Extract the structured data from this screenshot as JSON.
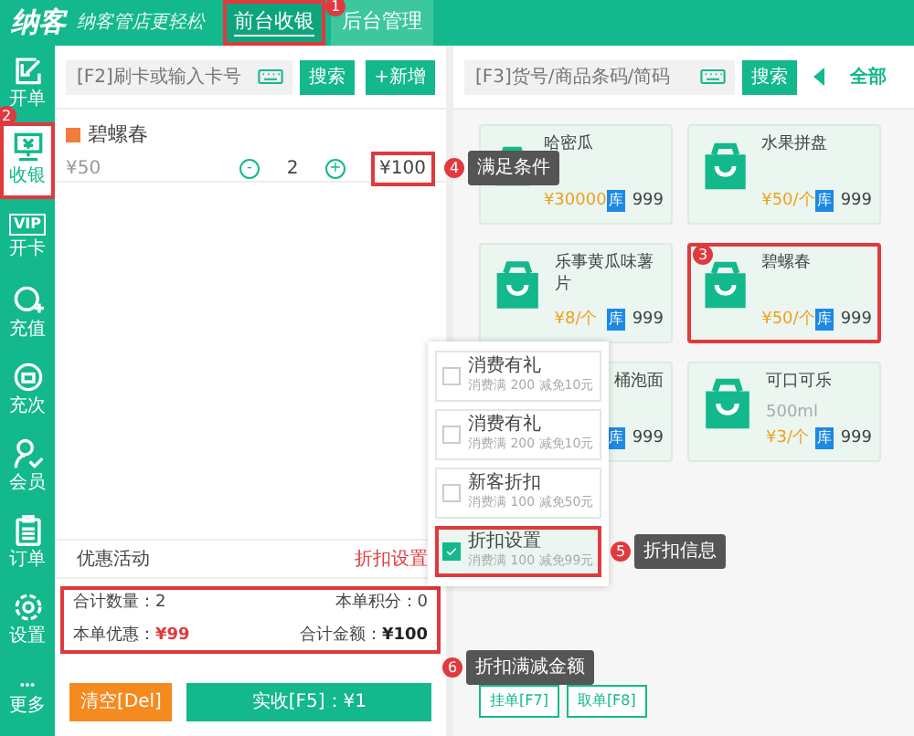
{
  "header": {
    "logo": "纳客",
    "slogan": "纳客管店更轻松",
    "tabs": [
      {
        "label": "前台收银",
        "selected": true,
        "highlight": true,
        "callout": "1"
      },
      {
        "label": "后台管理",
        "selected": false
      }
    ]
  },
  "sidebar": {
    "items": [
      {
        "label": "开单",
        "selected": false
      },
      {
        "label": "收银",
        "selected": true,
        "highlight": true,
        "callout": "2"
      },
      {
        "label": "开卡",
        "icon_text": "VIP",
        "selected": false
      },
      {
        "label": "充值",
        "selected": false
      },
      {
        "label": "充次",
        "selected": false
      },
      {
        "label": "会员",
        "selected": false
      },
      {
        "label": "订单",
        "selected": false
      },
      {
        "label": "设置",
        "selected": false
      },
      {
        "label": "更多",
        "selected": false
      }
    ]
  },
  "cart": {
    "search_placeholder": "[F2]刷卡或输入卡号",
    "search_button": "搜索",
    "add_button": "+新增",
    "items": [
      {
        "name": "碧螺春",
        "unit_price": "¥50",
        "minus": "-",
        "quantity": "2",
        "plus": "+",
        "subtotal": "¥100",
        "highlight": true,
        "callout": "4",
        "tooltip": "满足条件"
      }
    ],
    "promotion": {
      "label": "优惠活动",
      "value": "折扣设置"
    },
    "summary": {
      "highlight": true,
      "callout": "6",
      "tooltip": "折扣满减金额",
      "fields": [
        {
          "label": "合计数量：",
          "value": "2",
          "kind": "plain"
        },
        {
          "label": "本单积分：",
          "value": "0",
          "kind": "plain"
        },
        {
          "label": "本单优惠：",
          "value": "¥99",
          "kind": "discount"
        },
        {
          "label": "合计金额：",
          "value": "¥100",
          "kind": "total"
        }
      ]
    },
    "buttons": [
      {
        "label": "清空[Del]",
        "kind": "clear"
      },
      {
        "label": "实收[F5]：¥1",
        "kind": "pay"
      }
    ]
  },
  "products": {
    "search_placeholder": "[F3]货号/商品条码/简码",
    "search_button": "搜索",
    "categories": [
      {
        "label": "全部",
        "selected": true
      }
    ],
    "items": [
      {
        "name": "哈密瓜",
        "price": "¥30000",
        "stock_label": "库",
        "stock": "999"
      },
      {
        "name": "水果拼盘",
        "price": "¥50/个",
        "stock_label": "库",
        "stock": "999"
      },
      {
        "name": "乐事黄瓜味薯片",
        "price": "¥8/个",
        "stock_label": "库",
        "stock": "999"
      },
      {
        "name": "碧螺春",
        "price": "¥50/个",
        "stock_label": "库",
        "stock": "999",
        "highlight": true,
        "callout": "3"
      },
      {
        "name": "桶泡面",
        "stock_label": "库",
        "stock": "999"
      },
      {
        "name": "可口可乐",
        "spec": "500ml",
        "price": "¥3/个",
        "stock_label": "库",
        "stock": "999"
      }
    ],
    "buttons": [
      "挂单[F7]",
      "取单[F8]"
    ]
  },
  "discount_popup": {
    "options": [
      {
        "title": "消费有礼",
        "detail": "消费满 200 减免10元",
        "checked": false
      },
      {
        "title": "消费有礼",
        "detail": "消费满 200 减免10元",
        "checked": false
      },
      {
        "title": "新客折扣",
        "detail": "消费满 100 减免50元",
        "checked": false
      },
      {
        "title": "折扣设置",
        "detail": "消费满 100 减免99元",
        "checked": true,
        "highlight": true,
        "callout": "5",
        "tooltip": "折扣信息"
      }
    ]
  }
}
